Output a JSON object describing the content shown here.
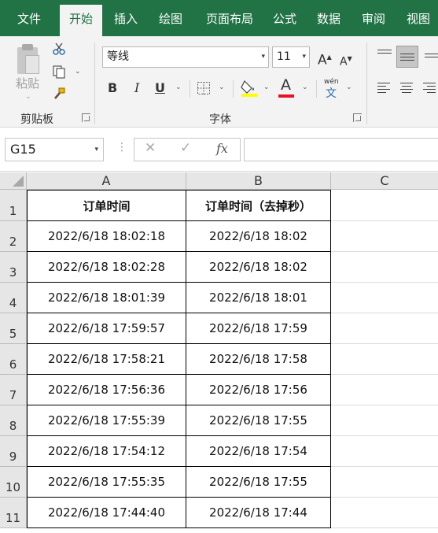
{
  "tabs": [
    "文件",
    "开始",
    "插入",
    "绘图",
    "页面布局",
    "公式",
    "数据",
    "审阅",
    "视图"
  ],
  "active_tab": "开始",
  "clipboard": {
    "paste_label": "粘贴",
    "group_label": "剪贴板"
  },
  "font": {
    "name": "等线",
    "size": "11",
    "group_label": "字体",
    "bold": "B",
    "italic": "I",
    "underline": "U",
    "font_color": "A",
    "grow": "A",
    "shrink": "A",
    "phonetic_top": "wén",
    "phonetic_bottom": "文",
    "font_color_hex": "#e81123",
    "fill_color_hex": "#ffff00"
  },
  "formula_bar": {
    "cell_ref": "G15",
    "fx": "fx",
    "cancel": "✕",
    "enter": "✓",
    "value": ""
  },
  "columns": [
    "A",
    "B",
    "C"
  ],
  "rows": [
    "1",
    "2",
    "3",
    "4",
    "5",
    "6",
    "7",
    "8",
    "9",
    "10",
    "11"
  ],
  "table": {
    "headers": [
      "订单时间",
      "订单时间（去掉秒）"
    ],
    "data": [
      [
        "2022/6/18 18:02:18",
        "2022/6/18 18:02"
      ],
      [
        "2022/6/18 18:02:28",
        "2022/6/18 18:02"
      ],
      [
        "2022/6/18 18:01:39",
        "2022/6/18 18:01"
      ],
      [
        "2022/6/18 17:59:57",
        "2022/6/18 17:59"
      ],
      [
        "2022/6/18 17:58:21",
        "2022/6/18 17:58"
      ],
      [
        "2022/6/18 17:56:36",
        "2022/6/18 17:56"
      ],
      [
        "2022/6/18 17:55:39",
        "2022/6/18 17:55"
      ],
      [
        "2022/6/18 17:54:12",
        "2022/6/18 17:54"
      ],
      [
        "2022/6/18 17:55:35",
        "2022/6/18 17:55"
      ],
      [
        "2022/6/18 17:44:40",
        "2022/6/18 17:44"
      ]
    ]
  }
}
